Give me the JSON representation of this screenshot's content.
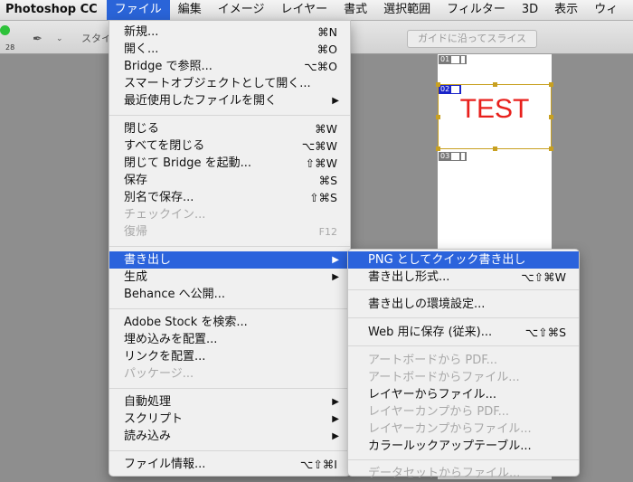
{
  "menubar": {
    "app": "Photoshop CC",
    "items": [
      "ファイル",
      "編集",
      "イメージ",
      "レイヤー",
      "書式",
      "選択範囲",
      "フィルター",
      "3D",
      "表示",
      "ウィ"
    ]
  },
  "options": {
    "style_label": "スタイ",
    "slice_button": "ガイドに沿ってスライス",
    "ruler": "28"
  },
  "canvas": {
    "slices": [
      "01",
      "02",
      "03"
    ],
    "text": "TEST"
  },
  "file_menu": {
    "items": [
      {
        "label": "新規...",
        "shortcut": "⌘N"
      },
      {
        "label": "開く...",
        "shortcut": "⌘O"
      },
      {
        "label": "Bridge で参照...",
        "shortcut": "⌥⌘O"
      },
      {
        "label": "スマートオブジェクトとして開く...",
        "shortcut": ""
      },
      {
        "label": "最近使用したファイルを開く",
        "shortcut": ""
      },
      {
        "label": "閉じる",
        "shortcut": "⌘W"
      },
      {
        "label": "すべてを閉じる",
        "shortcut": "⌥⌘W"
      },
      {
        "label": "閉じて Bridge を起動...",
        "shortcut": "⇧⌘W"
      },
      {
        "label": "保存",
        "shortcut": "⌘S"
      },
      {
        "label": "別名で保存...",
        "shortcut": "⇧⌘S"
      },
      {
        "label": "チェックイン...",
        "shortcut": ""
      },
      {
        "label": "復帰",
        "shortcut": "F12"
      },
      {
        "label": "書き出し",
        "shortcut": ""
      },
      {
        "label": "生成",
        "shortcut": ""
      },
      {
        "label": "Behance へ公開...",
        "shortcut": ""
      },
      {
        "label": "Adobe Stock を検索...",
        "shortcut": ""
      },
      {
        "label": "埋め込みを配置...",
        "shortcut": ""
      },
      {
        "label": "リンクを配置...",
        "shortcut": ""
      },
      {
        "label": "パッケージ...",
        "shortcut": ""
      },
      {
        "label": "自動処理",
        "shortcut": ""
      },
      {
        "label": "スクリプト",
        "shortcut": ""
      },
      {
        "label": "読み込み",
        "shortcut": ""
      },
      {
        "label": "ファイル情報...",
        "shortcut": "⌥⇧⌘I"
      }
    ]
  },
  "export_submenu": {
    "items": [
      {
        "label": "PNG としてクイック書き出し",
        "shortcut": ""
      },
      {
        "label": "書き出し形式...",
        "shortcut": "⌥⇧⌘W"
      },
      {
        "label": "書き出しの環境設定...",
        "shortcut": ""
      },
      {
        "label": "Web 用に保存 (従来)...",
        "shortcut": "⌥⇧⌘S"
      },
      {
        "label": "アートボードから PDF...",
        "shortcut": ""
      },
      {
        "label": "アートボードからファイル...",
        "shortcut": ""
      },
      {
        "label": "レイヤーからファイル...",
        "shortcut": ""
      },
      {
        "label": "レイヤーカンプから PDF...",
        "shortcut": ""
      },
      {
        "label": "レイヤーカンプからファイル...",
        "shortcut": ""
      },
      {
        "label": "カラールックアップテーブル...",
        "shortcut": ""
      },
      {
        "label": "データセットからファイル...",
        "shortcut": ""
      }
    ]
  }
}
